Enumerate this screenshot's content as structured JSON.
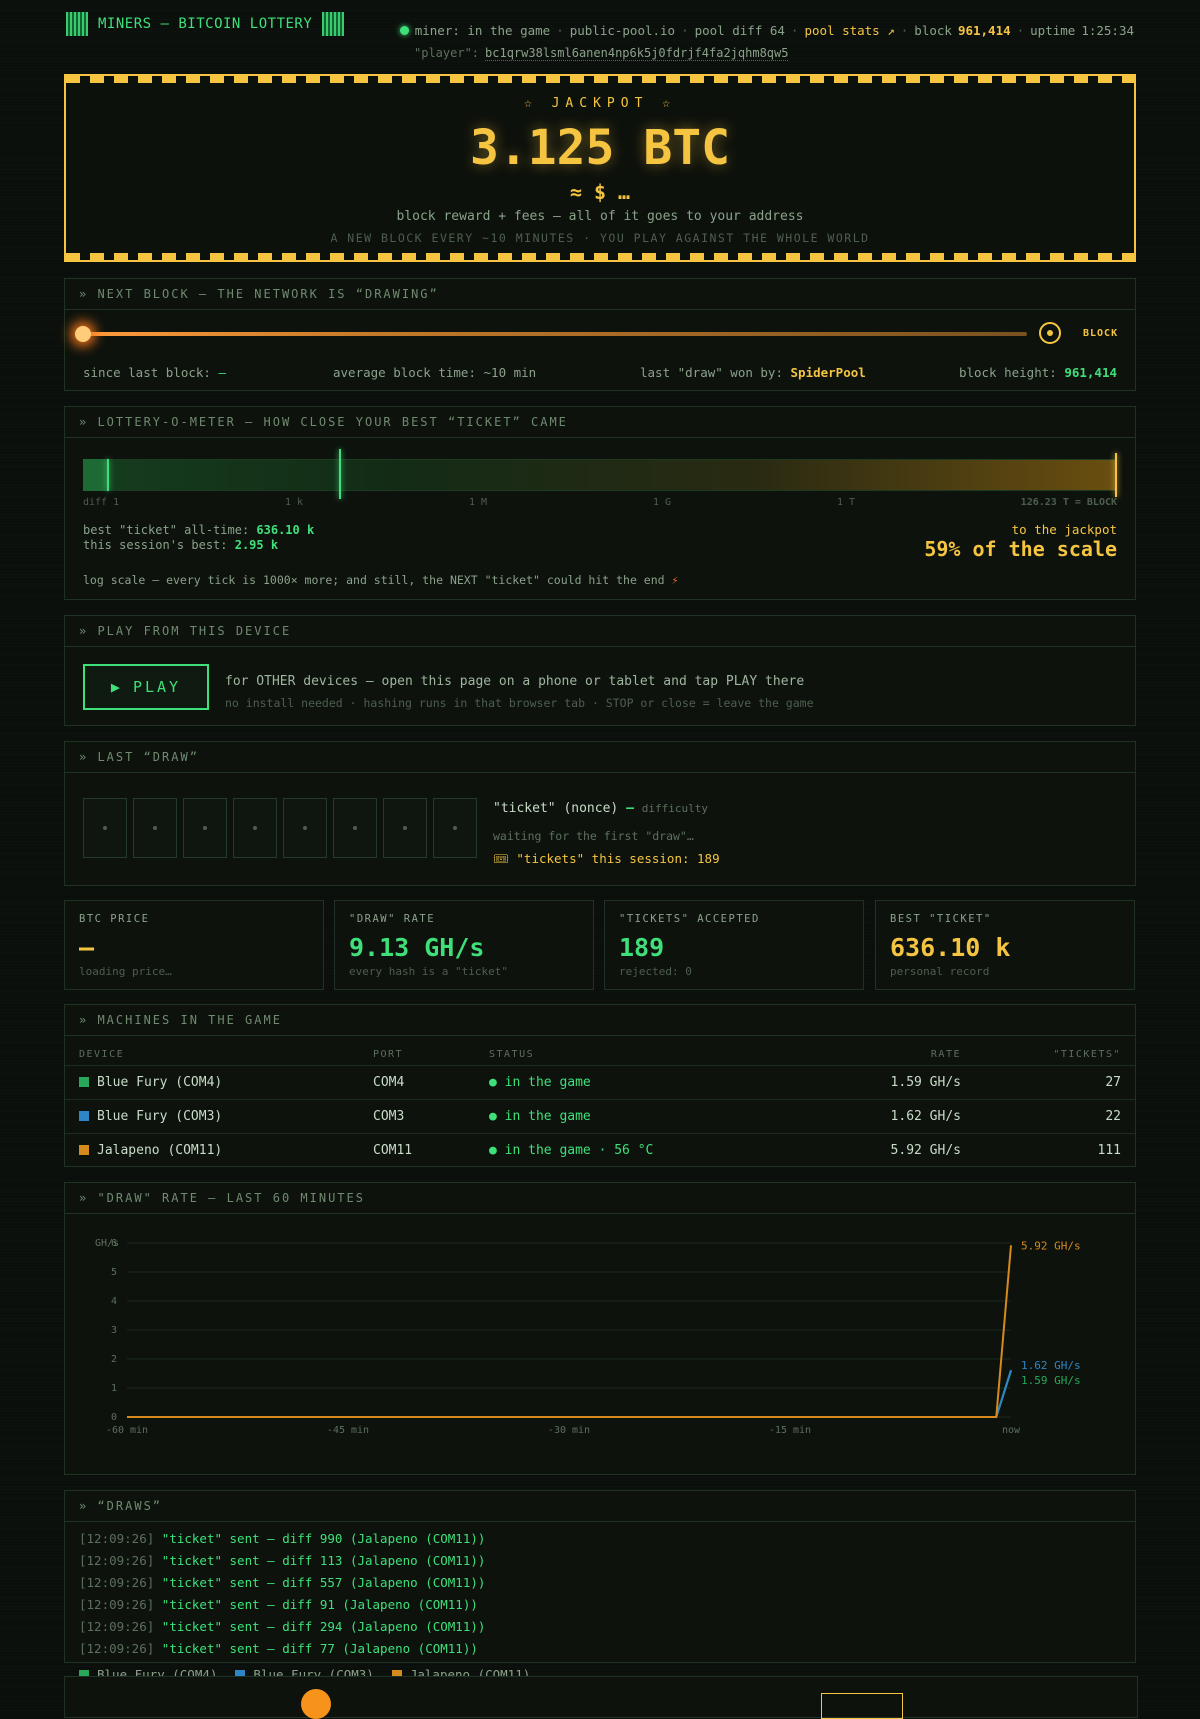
{
  "header": {
    "logo_text": "MINERS — BITCOIN LOTTERY",
    "miner_status": "miner: in the game",
    "pool": "public-pool.io",
    "pool_diff": "pool diff 64",
    "pool_stats_link": "pool stats ↗",
    "block_label": "block",
    "block_value": "961,414",
    "uptime_label": "uptime",
    "uptime_value": "1:25:34",
    "player_label": "\"player\":",
    "player_address": "bc1qrw38lsml6anen4np6k5j0fdrjf4fa2jqhm8qw5"
  },
  "jackpot": {
    "title": "☆ JACKPOT ☆",
    "amount": "3.125 BTC",
    "usd": "≈ $ …",
    "subtitle": "block reward + fees — all of it goes to your address",
    "note": "A NEW BLOCK EVERY ~10 MINUTES · YOU PLAY AGAINST THE WHOLE WORLD"
  },
  "next_block": {
    "title": "» NEXT BLOCK — THE NETWORK IS “DRAWING”",
    "block_label": "BLOCK",
    "since_label": "since last block:",
    "since_value": "—",
    "avg_label": "average block time:",
    "avg_value": "~10 min",
    "won_label": "last \"draw\" won by:",
    "won_value": "SpiderPool",
    "height_label": "block height:",
    "height_value": "961,414"
  },
  "meter": {
    "title": "» LOTTERY-O-METER — HOW CLOSE YOUR BEST “TICKET” CAME",
    "ticks": [
      "diff 1",
      "1 k",
      "1 M",
      "1 G",
      "1 T"
    ],
    "end_label": "126.23 T = BLOCK",
    "best_label": "best \"ticket\" all-time:",
    "best_value": "636.10 k",
    "session_label": "this session's best:",
    "session_value": "2.95 k",
    "to_jackpot": "to the jackpot",
    "scale_pct": "59% of the scale",
    "scale_fraction": 0.59,
    "note": "log scale — every tick is 1000× more; and still, the NEXT \"ticket\" could hit the end"
  },
  "play": {
    "title": "» PLAY FROM THIS DEVICE",
    "button": "PLAY",
    "text1": "for OTHER devices — open this page on a phone or tablet and tap PLAY there",
    "text2": "no install needed · hashing runs in that browser tab · STOP or close = leave the game"
  },
  "last_draw": {
    "title": "» LAST “DRAW”",
    "nonce_label": "\"ticket\" (nonce)",
    "nonce_value": "—",
    "difficulty_label": "difficulty",
    "waiting": "waiting for the first \"draw\"…",
    "session_tickets": "\"tickets\" this session: 189"
  },
  "stats": [
    {
      "label": "BTC PRICE",
      "value": "—",
      "sub": "loading price…",
      "color": "#f5c542"
    },
    {
      "label": "\"DRAW\" RATE",
      "value": "9.13 GH/s",
      "sub": "every hash is a \"ticket\"",
      "color": "#3fe07a"
    },
    {
      "label": "\"TICKETS\" ACCEPTED",
      "value": "189",
      "sub": "rejected: 0",
      "color": "#3fe07a"
    },
    {
      "label": "BEST \"TICKET\"",
      "value": "636.10 k",
      "sub": "personal record",
      "color": "#f5c542"
    }
  ],
  "machines": {
    "title": "» MACHINES IN THE GAME",
    "columns": [
      "DEVICE",
      "PORT",
      "STATUS",
      "RATE",
      "\"TICKETS\""
    ],
    "rows": [
      {
        "device": "Blue Fury (COM4)",
        "port": "COM4",
        "status": "● in the game",
        "rate": "1.59 GH/s",
        "tickets": "27",
        "color": "#27a85a"
      },
      {
        "device": "Blue Fury (COM3)",
        "port": "COM3",
        "status": "● in the game",
        "rate": "1.62 GH/s",
        "tickets": "22",
        "color": "#2e86c8"
      },
      {
        "device": "Jalapeno (COM11)",
        "port": "COM11",
        "status": "● in the game · 56 °C",
        "rate": "5.92 GH/s",
        "tickets": "111",
        "color": "#d68a1c"
      }
    ]
  },
  "chart_data": {
    "type": "line",
    "title": "» \"DRAW\" RATE — LAST 60 MINUTES",
    "ylabel": "GH/s",
    "ylim": [
      0,
      6
    ],
    "yticks": [
      "0",
      "1",
      "2",
      "3",
      "4",
      "5",
      "6"
    ],
    "x": [
      -60,
      -1,
      0
    ],
    "xticks": [
      "-60 min",
      "-45 min",
      "-30 min",
      "-15 min",
      "now"
    ],
    "series": [
      {
        "name": "Blue Fury (COM4)",
        "values": [
          0,
          0,
          1.59
        ],
        "end_label": "1.59 GH/s",
        "color": "#27a85a"
      },
      {
        "name": "Blue Fury (COM3)",
        "values": [
          0,
          0,
          1.62
        ],
        "end_label": "1.62 GH/s",
        "color": "#2e86c8"
      },
      {
        "name": "Jalapeno (COM11)",
        "values": [
          0,
          0,
          5.92
        ],
        "end_label": "5.92 GH/s",
        "color": "#d68a1c"
      }
    ]
  },
  "draws": {
    "title": "» “DRAWS”",
    "entries": [
      {
        "ts": "[12:09:26]",
        "msg": "\"ticket\" sent — diff 990 (Jalapeno (COM11))"
      },
      {
        "ts": "[12:09:26]",
        "msg": "\"ticket\" sent — diff 113 (Jalapeno (COM11))"
      },
      {
        "ts": "[12:09:26]",
        "msg": "\"ticket\" sent — diff 557 (Jalapeno (COM11))"
      },
      {
        "ts": "[12:09:26]",
        "msg": "\"ticket\" sent — diff 91 (Jalapeno (COM11))"
      },
      {
        "ts": "[12:09:26]",
        "msg": "\"ticket\" sent — diff 294 (Jalapeno (COM11))"
      },
      {
        "ts": "[12:09:26]",
        "msg": "\"ticket\" sent — diff 77 (Jalapeno (COM11))"
      }
    ]
  }
}
